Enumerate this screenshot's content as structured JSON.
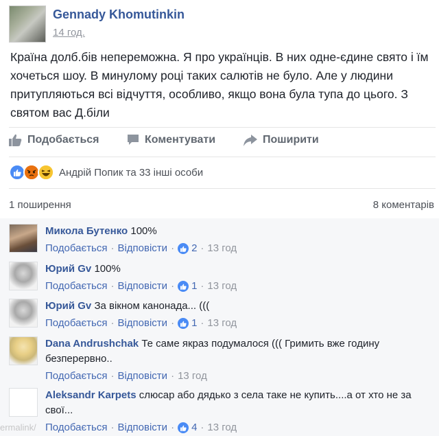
{
  "post": {
    "author": "Gennady Khomutinkin",
    "time": "14 год.",
    "text": "Країна долб.бів непереможна. Я про українців. В них одне-єдине свято і їм хочеться шоу. В минулому році таких салютів не було. Але у людини притупляються всі відчуття, особливо, якщо вона була тупа до цього. З святом вас Д.біли"
  },
  "actions": {
    "like": "Подобається",
    "comment": "Коментувати",
    "share": "Поширити"
  },
  "reactions": {
    "icons": [
      "like-icon",
      "angry-icon",
      "haha-icon"
    ],
    "text": "Андрій Попик та 33 інші особи"
  },
  "stats": {
    "shares": "1 поширення",
    "comments": "8 коментарів"
  },
  "comments": [
    {
      "name": "Микола Бутенко",
      "text": "100%",
      "like": "Подобається",
      "reply": "Відповісти",
      "likes": "2",
      "time": "13 год"
    },
    {
      "name": "Юрий Gv",
      "text": "100%",
      "like": "Подобається",
      "reply": "Відповісти",
      "likes": "1",
      "time": "13 год"
    },
    {
      "name": "Юрий Gv",
      "text": "За вікном канонада... (((",
      "like": "Подобається",
      "reply": "Відповісти",
      "likes": "1",
      "time": "13 год"
    },
    {
      "name": "Dana Andrushchak",
      "text": "Те саме якраз подумалося ((( Гримить вже годину безперервно..",
      "like": "Подобається",
      "reply": "Відповісти",
      "likes": "",
      "time": "13 год"
    },
    {
      "name": "Aleksandr Karpets",
      "text": "слюсар або дядько з села таке не купить....а от хто не за свої...",
      "like": "Подобається",
      "reply": "Відповісти",
      "likes": "4",
      "time": "13 год"
    }
  ],
  "watermark": "ermalink/"
}
